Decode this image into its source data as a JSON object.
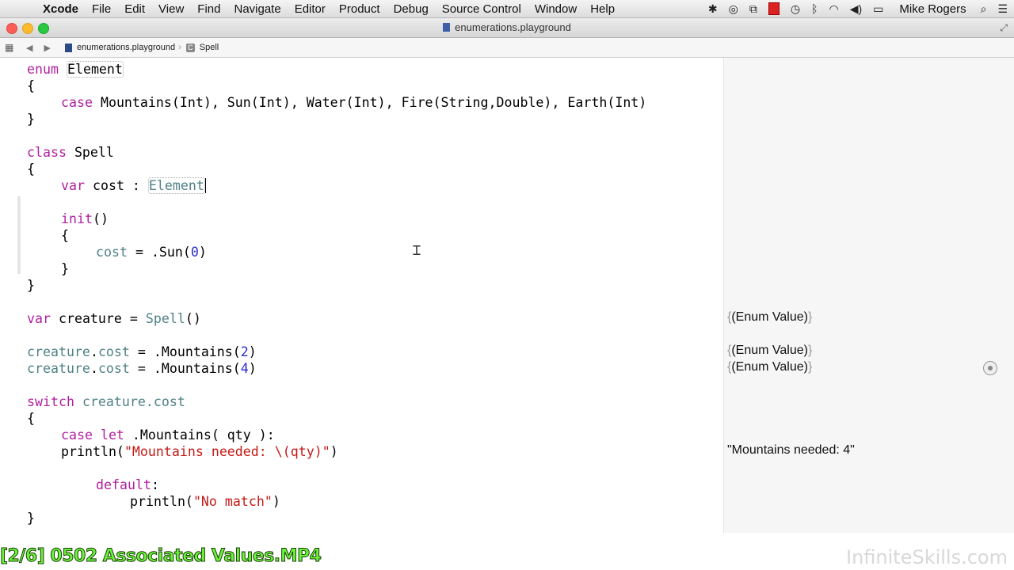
{
  "menubar": {
    "app_name": "Xcode",
    "items": [
      "File",
      "Edit",
      "View",
      "Find",
      "Navigate",
      "Editor",
      "Product",
      "Debug",
      "Source Control",
      "Window",
      "Help"
    ],
    "user": "Mike Rogers"
  },
  "window": {
    "title": "enumerations.playground"
  },
  "jumpbar": {
    "file": "enumerations.playground",
    "symbol": "Spell"
  },
  "code_lines": {
    "l1_kw": "enum",
    "l1_name": "Element",
    "l2": "{",
    "l3_kw": "case",
    "l3_rest": " Mountains(Int), Sun(Int), Water(Int), Fire(String,Double), Earth(Int)",
    "l4": "}",
    "l5_kw": "class",
    "l5_rest": " Spell",
    "l6": "{",
    "l7_kw": "var",
    "l7_rest": " cost : ",
    "l7_ph": "Element",
    "l8_kw": "init",
    "l8_rest": "()",
    "l9": "{",
    "l10_a": "cost",
    "l10_b": " = .Sun(",
    "l10_num": "0",
    "l10_c": ")",
    "l11": "}",
    "l12": "}",
    "l13_kw": "var",
    "l13_b": " creature = ",
    "l13_ty": "Spell",
    "l13_c": "()",
    "l14_a": "creature",
    "l14_b": ".",
    "l14_c": "cost",
    "l14_d": " = .Mountains(",
    "l14_num": "2",
    "l14_e": ")",
    "l15_a": "creature",
    "l15_b": ".",
    "l15_c": "cost",
    "l15_d": " = .Mountains(",
    "l15_num": "4",
    "l15_e": ")",
    "l16_kw": "switch",
    "l16_b": " ",
    "l16_c": "creature.cost",
    "l17": "{",
    "l18_kw": "case let",
    "l18_rest": " .Mountains( qty ):",
    "l19_a": "println(",
    "l19_str": "\"Mountains needed: \\(qty)\"",
    "l19_b": ")",
    "l20_kw": "default",
    "l20_rest": ":",
    "l21_a": "println(",
    "l21_str": "\"No match\"",
    "l21_b": ")",
    "l22": "}"
  },
  "results": {
    "r1": "(Enum Value)",
    "r2": "(Enum Value)",
    "r3": "(Enum Value)",
    "r4": "\"Mountains needed: 4\""
  },
  "overlay": {
    "video_label": "[2/6] 0502 Associated Values.MP4",
    "watermark": "InfiniteSkills.com"
  }
}
